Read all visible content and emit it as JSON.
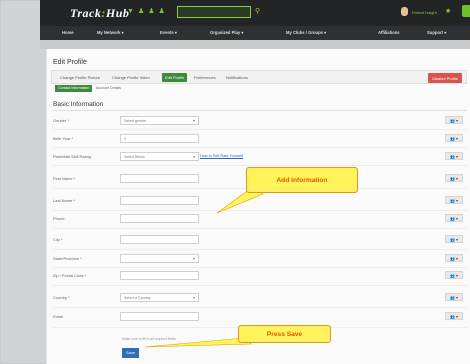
{
  "topbar": {
    "logo_left": "Track",
    "logo_colon": ":",
    "logo_right": "Hub",
    "username": "Robert Haight",
    "icons": [
      "trophy-icon",
      "people-icon",
      "people-icon",
      "people-icon"
    ]
  },
  "nav": {
    "items": [
      "Home",
      "My Network ▾",
      "Events ▾",
      "Organized Play ▾",
      "My Clubs / Groups ▾",
      "Affiliations",
      "Support ▾"
    ]
  },
  "page": {
    "title": "Edit Profile",
    "tabs": [
      "Change Profile Picture",
      "Change Profile Video",
      "Edit Profile",
      "Preferences",
      "Notifications"
    ],
    "active_tab": "Edit Profile",
    "disable_button": "Disable Profile",
    "subtabs": [
      "Contact Information",
      "Account Details"
    ],
    "section_title": "Basic Information"
  },
  "form": {
    "fields": [
      {
        "label": "Gender *",
        "value": "Select gender",
        "type": "select"
      },
      {
        "label": "Birth Year *",
        "value": "0",
        "type": "input"
      },
      {
        "label": "Pickleball Skill Rating",
        "value": "Select Below",
        "type": "select"
      },
      {
        "label": "First Name *",
        "value": "",
        "type": "input"
      },
      {
        "label": "Last Name *",
        "value": "",
        "type": "input"
      },
      {
        "label": "Phone",
        "value": "",
        "type": "input"
      },
      {
        "label": "City *",
        "value": "",
        "type": "input"
      },
      {
        "label": "State/Province *",
        "value": "",
        "type": "select"
      },
      {
        "label": "Zip / Postal Code *",
        "value": "",
        "type": "input"
      },
      {
        "label": "Country *",
        "value": "Select a Country",
        "type": "select"
      },
      {
        "label": "Email",
        "value": "",
        "type": "input"
      }
    ],
    "help_link": "How to Self Rate Yourself",
    "hint": "Make sure to fill in all required fields",
    "save_label": "Save",
    "privacy_glyph": "👥 ▾"
  },
  "callouts": {
    "add_info": "Add Information",
    "press_save": "Press Save"
  },
  "colors": {
    "accent_green": "#3d8a3d",
    "callout_fill": "#fff35a",
    "callout_text": "#e05a00",
    "danger": "#d9534f",
    "save_blue": "#2f6db5"
  }
}
